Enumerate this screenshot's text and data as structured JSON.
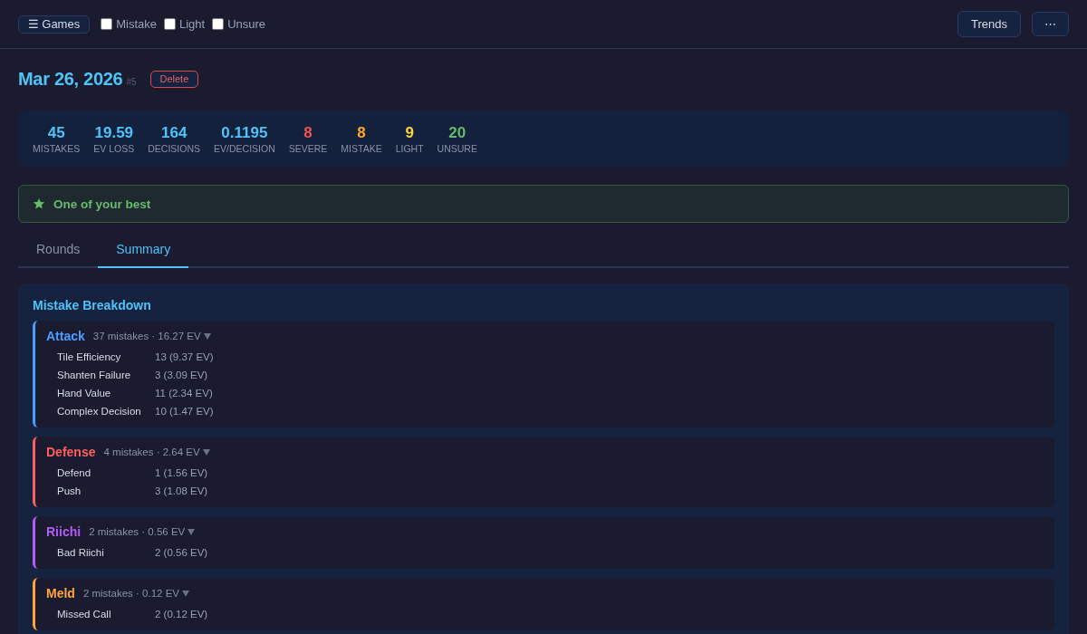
{
  "header": {
    "games_button": "☰ Games",
    "filters": [
      {
        "label": "Mistake",
        "checked": false
      },
      {
        "label": "Light",
        "checked": false
      },
      {
        "label": "Unsure",
        "checked": false
      }
    ],
    "trends_button": "Trends",
    "more_button": "⋯"
  },
  "game": {
    "title": "Mar 26, 2026",
    "number": "#5",
    "delete_button": "Delete"
  },
  "stats": [
    {
      "value": "45",
      "label": "MISTAKES",
      "color": "#4fc3f7"
    },
    {
      "value": "19.59",
      "label": "EV LOSS",
      "color": "#4fc3f7"
    },
    {
      "value": "164",
      "label": "DECISIONS",
      "color": "#4fc3f7"
    },
    {
      "value": "0.1195",
      "label": "EV/DECISION",
      "color": "#4fc3f7"
    },
    {
      "value": "8",
      "label": "SEVERE",
      "color": "#ef5350"
    },
    {
      "value": "8",
      "label": "MISTAKE",
      "color": "#ffa726"
    },
    {
      "value": "9",
      "label": "LIGHT",
      "color": "#fdd835"
    },
    {
      "value": "20",
      "label": "UNSURE",
      "color": "#66bb6a"
    }
  ],
  "banner": {
    "text": "One of your best"
  },
  "tabs": [
    {
      "label": "Rounds",
      "selected": false
    },
    {
      "label": "Summary",
      "selected": true
    }
  ],
  "breakdown": {
    "title": "Mistake Breakdown",
    "categories": [
      {
        "name": "Attack",
        "summary": "37 mistakes · 16.27 EV",
        "color": "#4a9eff",
        "expanded": true,
        "items": [
          {
            "name": "Tile Efficiency",
            "value": "13 (9.37 EV)"
          },
          {
            "name": "Shanten Failure",
            "value": "3 (3.09 EV)"
          },
          {
            "name": "Hand Value",
            "value": "11 (2.34 EV)"
          },
          {
            "name": "Complex Decision",
            "value": "10 (1.47 EV)"
          }
        ]
      },
      {
        "name": "Defense",
        "summary": "4 mistakes · 2.64 EV",
        "color": "#ff5f5f",
        "expanded": true,
        "items": [
          {
            "name": "Defend",
            "value": "1 (1.56 EV)"
          },
          {
            "name": "Push",
            "value": "3 (1.08 EV)"
          }
        ]
      },
      {
        "name": "Riichi",
        "summary": "2 mistakes · 0.56 EV",
        "color": "#b45cf5",
        "expanded": true,
        "items": [
          {
            "name": "Bad Riichi",
            "value": "2 (0.56 EV)"
          }
        ]
      },
      {
        "name": "Meld",
        "summary": "2 mistakes · 0.12 EV",
        "color": "#ffa53c",
        "expanded": true,
        "items": [
          {
            "name": "Missed Call",
            "value": "2 (0.12 EV)"
          }
        ]
      }
    ]
  }
}
